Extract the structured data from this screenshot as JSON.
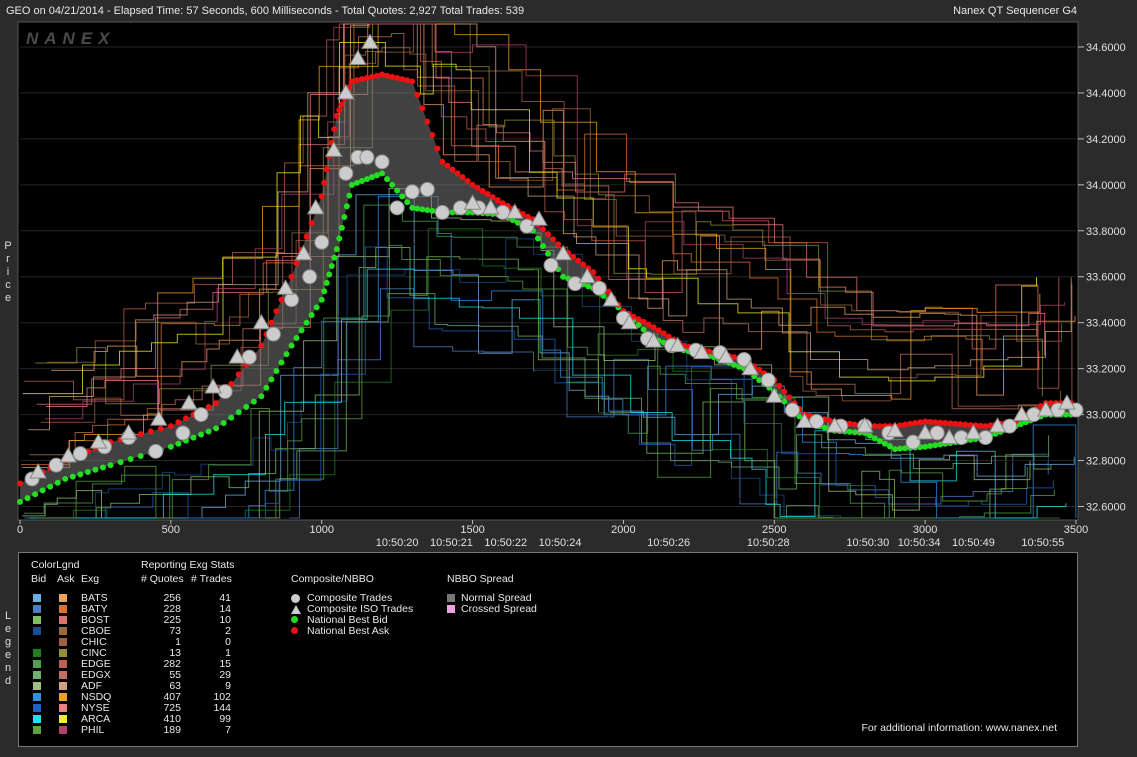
{
  "title_left": "GEO on 04/21/2014  -  Elapsed Time: 57 Seconds, 600 Milliseconds  -  Total Quotes: 2,927  Total Trades: 539",
  "title_right": "Nanex QT Sequencer G4",
  "watermark": "NANEX",
  "y_axis_label": "Price",
  "legend_side_label": "Legend",
  "chart_data": {
    "type": "line",
    "title": "",
    "ylabel": "Price",
    "xlim": [
      0,
      3500
    ],
    "ylim": [
      32.55,
      34.7
    ],
    "x_ticks": [
      0,
      500,
      1000,
      1500,
      2000,
      2500,
      3000,
      3500
    ],
    "y_ticks": [
      "34.6000",
      "34.4000",
      "34.2000",
      "34.0000",
      "33.8000",
      "33.6000",
      "33.4000",
      "33.2000",
      "33.0000",
      "32.8000",
      "32.6000"
    ],
    "time_labels": [
      {
        "x": 1250,
        "label": "10:50:20"
      },
      {
        "x": 1430,
        "label": "10:50:21"
      },
      {
        "x": 1610,
        "label": "10:50:22"
      },
      {
        "x": 1790,
        "label": "10:50:24"
      },
      {
        "x": 2150,
        "label": "10:50:26"
      },
      {
        "x": 2480,
        "label": "10:50:28"
      },
      {
        "x": 2810,
        "label": "10:50:30"
      },
      {
        "x": 2980,
        "label": "10:50:34"
      },
      {
        "x": 3160,
        "label": "10:50:49"
      },
      {
        "x": 3390,
        "label": "10:50:55"
      }
    ],
    "series": [
      {
        "name": "National Best Bid",
        "color": "#22dd22",
        "x": [
          0,
          150,
          300,
          500,
          650,
          800,
          900,
          1000,
          1050,
          1100,
          1200,
          1300,
          1400,
          1500,
          1600,
          1700,
          1800,
          1900,
          2000,
          2100,
          2200,
          2300,
          2400,
          2500,
          2600,
          2700,
          2800,
          2900,
          3000,
          3100,
          3200,
          3300,
          3400,
          3500
        ],
        "values": [
          32.62,
          32.72,
          32.78,
          32.86,
          32.94,
          33.08,
          33.3,
          33.5,
          33.72,
          34.0,
          34.05,
          33.9,
          33.88,
          33.88,
          33.87,
          33.8,
          33.6,
          33.55,
          33.45,
          33.33,
          33.28,
          33.25,
          33.2,
          33.1,
          32.97,
          32.93,
          32.92,
          32.85,
          32.86,
          32.88,
          32.9,
          32.95,
          33.0,
          33.0
        ]
      },
      {
        "name": "National Best Ask",
        "color": "#ee1111",
        "x": [
          0,
          150,
          300,
          500,
          650,
          800,
          900,
          1000,
          1050,
          1100,
          1200,
          1300,
          1400,
          1500,
          1600,
          1700,
          1800,
          1900,
          2000,
          2100,
          2200,
          2300,
          2400,
          2500,
          2600,
          2700,
          2800,
          2900,
          3000,
          3100,
          3200,
          3300,
          3400,
          3500
        ],
        "values": [
          32.7,
          32.8,
          32.88,
          32.95,
          33.05,
          33.3,
          33.6,
          33.95,
          34.3,
          34.45,
          34.48,
          34.45,
          34.1,
          34.0,
          33.92,
          33.85,
          33.72,
          33.62,
          33.45,
          33.38,
          33.3,
          33.27,
          33.24,
          33.15,
          33.0,
          32.97,
          32.95,
          32.95,
          32.97,
          32.96,
          32.95,
          32.97,
          33.05,
          33.05
        ]
      },
      {
        "name": "Composite Trades",
        "color": "#cccccc",
        "x": [
          40,
          120,
          200,
          280,
          360,
          450,
          540,
          600,
          680,
          760,
          840,
          900,
          960,
          1000,
          1080,
          1120,
          1150,
          1200,
          1250,
          1300,
          1350,
          1400,
          1460,
          1520,
          1600,
          1680,
          1760,
          1840,
          1920,
          2000,
          2080,
          2160,
          2240,
          2320,
          2400,
          2480,
          2560,
          2640,
          2720,
          2800,
          2880,
          2960,
          3040,
          3120,
          3200,
          3280,
          3360,
          3440,
          3500
        ],
        "values": [
          32.72,
          32.78,
          32.83,
          32.86,
          32.9,
          32.84,
          32.92,
          33.0,
          33.1,
          33.25,
          33.35,
          33.5,
          33.6,
          33.75,
          34.05,
          34.12,
          34.12,
          34.1,
          33.9,
          33.97,
          33.98,
          33.88,
          33.9,
          33.9,
          33.88,
          33.82,
          33.65,
          33.57,
          33.55,
          33.42,
          33.33,
          33.3,
          33.28,
          33.27,
          33.24,
          33.15,
          33.02,
          32.97,
          32.95,
          32.95,
          32.92,
          32.88,
          32.92,
          32.9,
          32.9,
          32.95,
          33.0,
          33.02,
          33.02
        ]
      },
      {
        "name": "Composite ISO Trades",
        "color": "#cccccc",
        "x": [
          60,
          160,
          260,
          360,
          460,
          560,
          640,
          720,
          800,
          880,
          940,
          980,
          1040,
          1080,
          1120,
          1160,
          1500,
          1560,
          1640,
          1720,
          1800,
          1880,
          1960,
          2020,
          2100,
          2180,
          2260,
          2340,
          2420,
          2500,
          2600,
          2700,
          2800,
          2900,
          3000,
          3080,
          3160,
          3240,
          3320,
          3400,
          3470
        ],
        "values": [
          32.75,
          32.82,
          32.88,
          32.92,
          32.98,
          33.05,
          33.12,
          33.25,
          33.4,
          33.55,
          33.7,
          33.9,
          34.15,
          34.4,
          34.55,
          34.62,
          33.92,
          33.9,
          33.88,
          33.85,
          33.7,
          33.6,
          33.5,
          33.4,
          33.32,
          33.3,
          33.27,
          33.25,
          33.2,
          33.08,
          32.97,
          32.95,
          32.95,
          32.93,
          32.92,
          32.9,
          32.92,
          32.95,
          33.0,
          33.02,
          33.05
        ]
      }
    ]
  },
  "legend": {
    "color_legend_header": "ColorLgnd",
    "col_bid": "Bid",
    "col_ask": "Ask",
    "col_exg": "Exg",
    "reporting_header": "Reporting Exg Stats",
    "col_quotes": "# Quotes",
    "col_trades": "# Trades",
    "rows": [
      {
        "exg": "BATS",
        "quotes": "256",
        "trades": "41",
        "bid": "#6aaee8",
        "ask": "#f0a060"
      },
      {
        "exg": "BATY",
        "quotes": "228",
        "trades": "14",
        "bid": "#4a7ec8",
        "ask": "#e07030"
      },
      {
        "exg": "BOST",
        "quotes": "225",
        "trades": "10",
        "bid": "#80c060",
        "ask": "#e07070"
      },
      {
        "exg": "CBOE",
        "quotes": "73",
        "trades": "2",
        "bid": "#1a4e90",
        "ask": "#9a6a3a"
      },
      {
        "exg": "CHIC",
        "quotes": "1",
        "trades": "0",
        "bid": "#000000",
        "ask": "#a06040"
      },
      {
        "exg": "CINC",
        "quotes": "13",
        "trades": "1",
        "bid": "#208020",
        "ask": "#909030"
      },
      {
        "exg": "EDGE",
        "quotes": "282",
        "trades": "15",
        "bid": "#50a050",
        "ask": "#c06050"
      },
      {
        "exg": "EDGX",
        "quotes": "55",
        "trades": "29",
        "bid": "#70b070",
        "ask": "#c07060"
      },
      {
        "exg": "ADF",
        "quotes": "63",
        "trades": "9",
        "bid": "#a0c080",
        "ask": "#d0a080"
      },
      {
        "exg": "NSDQ",
        "quotes": "407",
        "trades": "102",
        "bid": "#3090e0",
        "ask": "#f0a020"
      },
      {
        "exg": "NYSE",
        "quotes": "725",
        "trades": "144",
        "bid": "#2060c0",
        "ask": "#f08080"
      },
      {
        "exg": "ARCA",
        "quotes": "410",
        "trades": "99",
        "bid": "#20e0f0",
        "ask": "#f0f020"
      },
      {
        "exg": "PHIL",
        "quotes": "189",
        "trades": "7",
        "bid": "#60a040",
        "ask": "#b04070"
      }
    ],
    "composite_header": "Composite/NBBO",
    "composite_items": [
      {
        "label": "Composite Trades",
        "shape": "circle",
        "color": "#cccccc"
      },
      {
        "label": "Composite ISO Trades",
        "shape": "triangle",
        "color": "#cccccc"
      },
      {
        "label": "National Best Bid",
        "shape": "dot",
        "color": "#22dd22"
      },
      {
        "label": "National Best Ask",
        "shape": "dot",
        "color": "#ee1111"
      }
    ],
    "spread_header": "NBBO Spread",
    "spread_items": [
      {
        "label": "Normal Spread",
        "color": "#777777"
      },
      {
        "label": "Crossed Spread",
        "color": "#f0a0e0"
      }
    ],
    "info": "For additional information: www.nanex.net"
  }
}
